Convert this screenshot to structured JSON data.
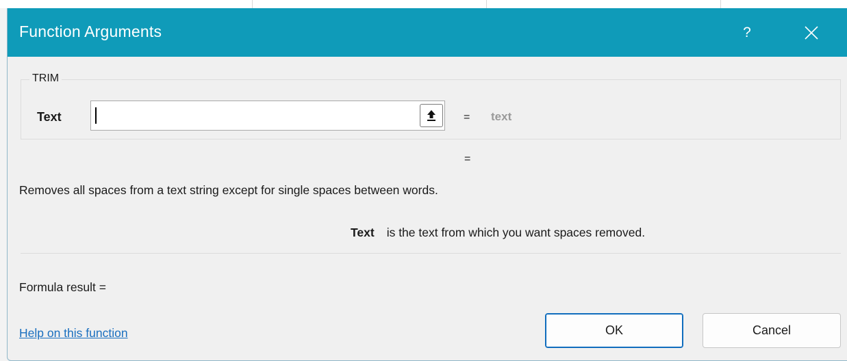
{
  "dialog": {
    "title": "Function Arguments",
    "help_glyph": "?",
    "close_icon": "close-icon",
    "accent_color": "#0f9bb9"
  },
  "function_group": {
    "name": "TRIM",
    "arguments": [
      {
        "label": "Text",
        "input_value": "",
        "equals": "=",
        "evaluated": "text"
      }
    ]
  },
  "result_equals": "=",
  "description": "Removes all spaces from a text string except for single spaces between words.",
  "param_help": {
    "name": "Text",
    "text": "is the text from which you want spaces removed."
  },
  "formula_result": "Formula result =",
  "help_link": "Help on this function",
  "buttons": {
    "ok": "OK",
    "cancel": "Cancel"
  }
}
